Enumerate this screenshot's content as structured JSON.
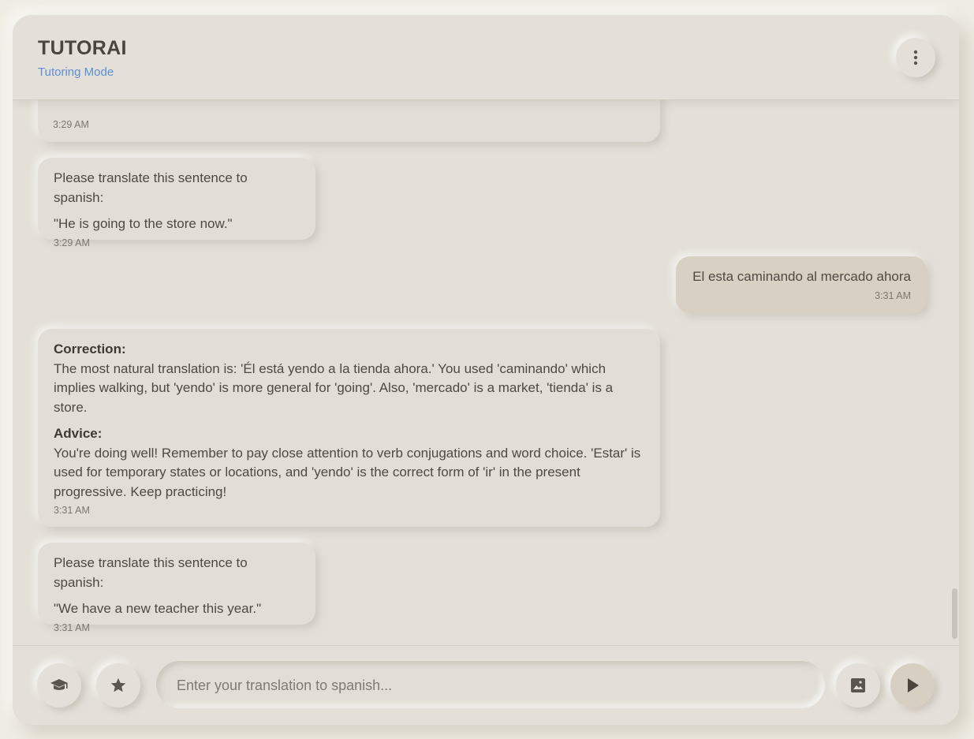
{
  "header": {
    "title": "TUTORAI",
    "subtitle": "Tutoring Mode",
    "menu_icon": "more-vertical-icon"
  },
  "messages": [
    {
      "role": "tutor",
      "partial": true,
      "time": "3:29 AM"
    },
    {
      "role": "tutor",
      "prompt": "Please translate this sentence to spanish:",
      "sentence": "\"He is going to the store now.\"",
      "time": "3:29 AM"
    },
    {
      "role": "user",
      "text": "El esta caminando al mercado ahora",
      "time": "3:31 AM"
    },
    {
      "role": "tutor",
      "correction_label": "Correction:",
      "correction_text": "The most natural translation is: 'Él está yendo a la tienda ahora.' You used 'caminando' which implies walking, but 'yendo' is more general for 'going'. Also, 'mercado' is a market, 'tienda' is a store.",
      "advice_label": "Advice:",
      "advice_text": "You're doing well! Remember to pay close attention to verb conjugations and word choice. 'Estar' is used for temporary states or locations, and 'yendo' is the correct form of 'ir' in the present progressive. Keep practicing!",
      "time": "3:31 AM"
    },
    {
      "role": "tutor",
      "prompt": "Please translate this sentence to spanish:",
      "sentence": "\"We have a new teacher this year.\"",
      "time": "3:31 AM"
    }
  ],
  "footer": {
    "mode_icon": "graduation-cap-icon",
    "favorite_icon": "star-icon",
    "input_placeholder": "Enter your translation to spanish...",
    "input_value": "",
    "image_icon": "image-icon",
    "send_icon": "play-send-icon"
  },
  "colors": {
    "background": "#efece3",
    "panel": "#e4e0d9",
    "user_bubble": "#d8d1c3",
    "accent": "#5b8fd0",
    "text": "#4e4941"
  }
}
